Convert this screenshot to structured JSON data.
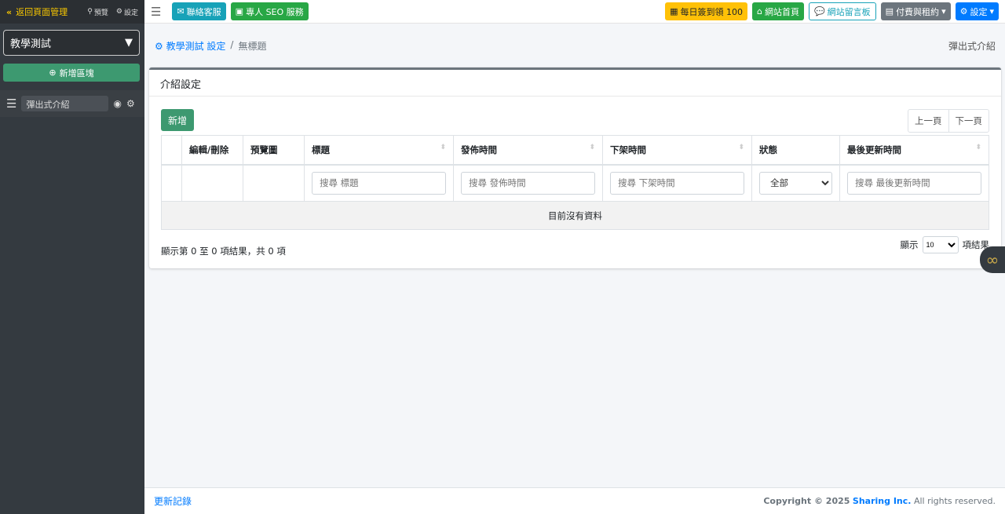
{
  "sidebar": {
    "back": "返回頁面管理",
    "preview": "預覽",
    "settings": "設定",
    "site_select": "教學測試",
    "add_block": "新增區塊",
    "items": [
      {
        "label": "彈出式介紹"
      }
    ]
  },
  "topbar": {
    "contact": "聯絡客服",
    "seo": "專人 SEO 服務",
    "checkin": "每日簽到領 100",
    "home": "網站首頁",
    "guestbook": "網站留言板",
    "billing": "付費與租約",
    "settings": "設定"
  },
  "colors": {
    "info": "#17a2b8",
    "success": "#28a745",
    "warning": "#ffc107",
    "secondary": "#6c757d",
    "primary": "#007bff",
    "sidebar": "#343a40"
  },
  "breadcrumb": {
    "parent": "教學測試 設定",
    "current": "無標題"
  },
  "page_right": "彈出式介紹",
  "card": {
    "title": "介紹設定",
    "add": "新增",
    "prev": "上一頁",
    "next": "下一頁",
    "columns": [
      "編輯/刪除",
      "預覽圖",
      "標題",
      "發佈時間",
      "下架時間",
      "狀態",
      "最後更新時間"
    ],
    "filters": {
      "title": "搜尋 標題",
      "publish": "搜尋 發佈時間",
      "unpublish": "搜尋 下架時間",
      "status": "全部",
      "updated": "搜尋 最後更新時間"
    },
    "empty": "目前沒有資料",
    "info": "顯示第 0 至 0 項結果，共 0 項",
    "show": "顯示",
    "page_size": "10",
    "results": "項結果"
  },
  "footer": {
    "changelog": "更新記錄",
    "copyright": "Copyright © 2025",
    "company": "Sharing Inc.",
    "rights": "All rights reserved."
  }
}
